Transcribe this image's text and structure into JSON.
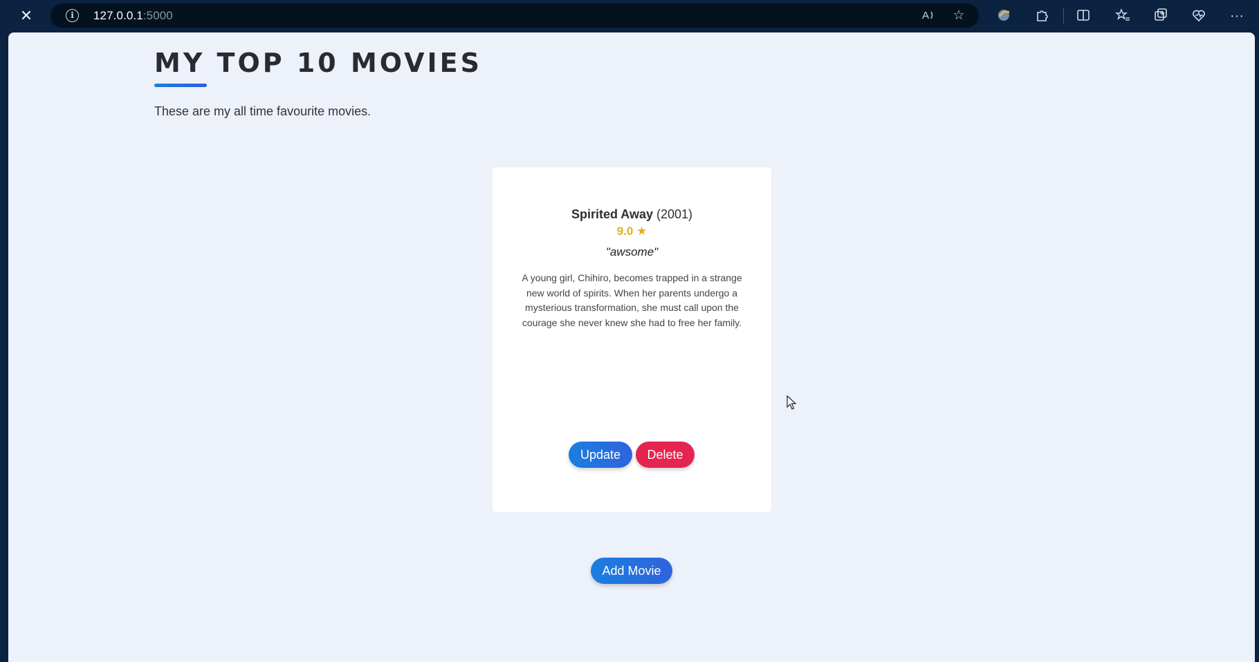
{
  "browser": {
    "url_host": "127.0.0.1",
    "url_port": ":5000",
    "icons": [
      "close-icon",
      "info-icon",
      "read-aloud-icon",
      "favorite-star-icon",
      "copilot-icon",
      "extensions-icon",
      "split-screen-icon",
      "favorites-icon",
      "collections-icon",
      "browser-essentials-icon",
      "more-icon"
    ]
  },
  "page": {
    "title": "MY TOP 10 MOVIES",
    "subtitle": "These are my all time favourite movies."
  },
  "movie": {
    "name": "Spirited Away",
    "year": "(2001)",
    "rating": "9.0",
    "review": "\"awsome\"",
    "description": "A young girl, Chihiro, becomes trapped in a strange new world of spirits. When her parents undergo a mysterious transformation, she must call upon the courage she never knew she had to free her family."
  },
  "actions": {
    "update_label": "Update",
    "delete_label": "Delete",
    "add_label": "Add Movie"
  },
  "colors": {
    "page_bg": "#edf1f9",
    "accent_blue": "#1a7fe0",
    "delete_red": "#e5244f",
    "star_gold": "#e3b01c"
  }
}
